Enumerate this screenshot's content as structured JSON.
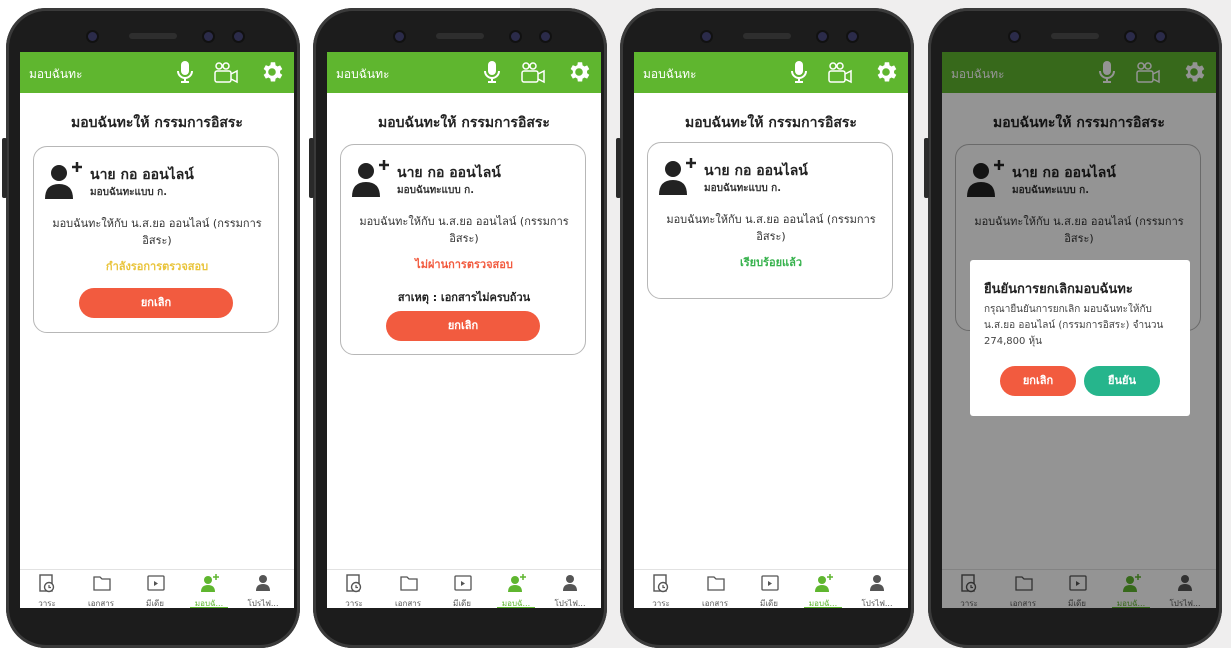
{
  "colors": {
    "appbar": "#5fb62f",
    "pending": "#e9c43b",
    "rejected": "#f25b3f",
    "ready": "#37b24d",
    "cancel_button": "#f25b3f",
    "confirm_button": "#26b58c"
  },
  "header": {
    "title": "มอบฉันทะ",
    "icons": [
      "microphone-icon",
      "video-call-icon",
      "gear-icon"
    ]
  },
  "page_title": "มอบฉันทะให้ กรรมการอิสระ",
  "card": {
    "name": "นาย กอ ออนไลน์",
    "proxy_type": "มอบฉันทะแบบ ก.",
    "description": "มอบฉันทะให้กับ น.ส.ยอ ออนไลน์ (กรรมการอิสระ)",
    "cancel_label": "ยกเลิก"
  },
  "screens": [
    {
      "status": "กำลังรอการตรวจสอบ"
    },
    {
      "status": "ไม่ผ่านการตรวจสอบ",
      "reason": "สาเหตุ : เอกสารไม่ครบถ้วน"
    },
    {
      "status": "เรียบร้อยแล้ว"
    },
    {
      "status": ""
    }
  ],
  "nav": {
    "items": [
      {
        "label": "วาระ",
        "icon": "agenda-icon"
      },
      {
        "label": "เอกสาร",
        "icon": "folder-icon"
      },
      {
        "label": "มีเดีย",
        "icon": "media-icon"
      },
      {
        "label": "มอบฉั...",
        "icon": "add-user-icon"
      },
      {
        "label": "โปรไฟ...",
        "icon": "profile-icon"
      }
    ]
  },
  "dialog": {
    "title": "ยืนยันการยกเลิกมอบฉันทะ",
    "message": "กรุณายืนยันการยกเลิก มอบฉันทะให้กับ น.ส.ยอ ออนไลน์ (กรรมการอิสระ) จำนวน 274,800 หุ้น",
    "cancel_label": "ยกเลิก",
    "confirm_label": "ยืนยัน"
  }
}
